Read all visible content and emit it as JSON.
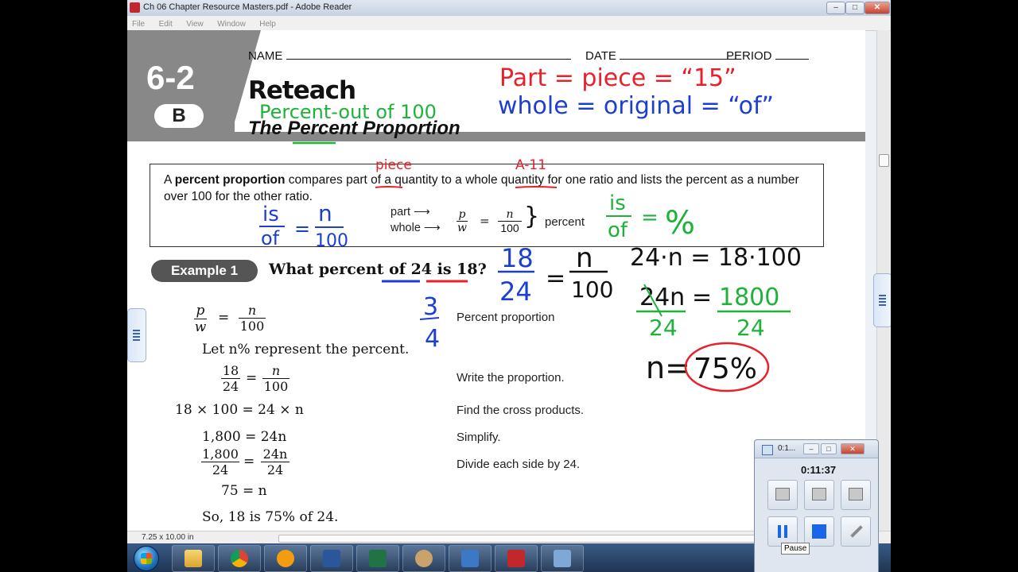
{
  "window": {
    "title": "Ch 06 Chapter Resource Masters.pdf - Adobe Reader",
    "min": "–",
    "max": "□",
    "close": "✕"
  },
  "menu": [
    "File",
    "Edit",
    "View",
    "Window",
    "Help"
  ],
  "doc": {
    "lesson_num": "6-2",
    "lesson_badge": "B",
    "name_label": "NAME",
    "date_label": "DATE",
    "period_label": "PERIOD",
    "heading": "Reteach",
    "subtitle": "The Percent Proportion",
    "def_bold": "percent proportion",
    "def_pre": "A ",
    "def_mid1": " compares ",
    "def_part": "part",
    "def_mid2": " of a quantity to a ",
    "def_whole": "whole",
    "def_post": " quantity for one ratio and lists the percent as a number over 100 for the other ratio.",
    "arrow_part": "part ⟶",
    "arrow_whole": "whole ⟶",
    "frac_p": "p",
    "frac_w": "w",
    "frac_n": "n",
    "frac_100": "100",
    "equals": "=",
    "brace": "}",
    "percent_word": "percent",
    "example_label": "Example 1",
    "example_q_pre": "What percent ",
    "example_q_of": "of 24",
    "example_q_is": "is 18",
    "example_q_end": "?",
    "eq1_p": "p",
    "eq1_w": "w",
    "eq1_n": "n",
    "eq1_100": "100",
    "let_line": "Let n% represent the percent.",
    "eq2_18": "18",
    "eq2_24": "24",
    "eq2_n": "n",
    "eq2_100": "100",
    "eq3": "18 × 100 = 24 × n",
    "eq4": "1,800 = 24n",
    "eq5_a": "1,800",
    "eq5_b": "24",
    "eq5_c": "24n",
    "eq5_d": "24",
    "eq6": "75 = n",
    "conclusion": "So, 18 is 75% of 24.",
    "steps": [
      "Percent proportion",
      "Write the proportion.",
      "Find the cross products.",
      "Simplify.",
      "Divide each side by 24."
    ]
  },
  "annotations": {
    "red_line1": "Part = piece = “15”",
    "blue_line2": "whole = original = “of”",
    "green_sub": "Percent-out of 100",
    "red_piece": "piece",
    "red_all": "A-11",
    "blue_is": "is",
    "blue_of": "of",
    "blue_eq": "=",
    "blue_n": "n",
    "blue_100": "100",
    "green_is": "is",
    "green_of": "of",
    "green_eq": "=",
    "green_pct": "%",
    "blue_18": "18",
    "blue_24": "24",
    "black_eq": "=",
    "black_n": "n",
    "black_100": "100",
    "black_cross": "24·n = 18·100",
    "black_24n": "24n",
    "black_eq2": "=",
    "black_1800": "1800",
    "green_24a": "24",
    "green_24b": "24",
    "blue_3": "3",
    "blue_4": "4",
    "black_n_eq": "n=",
    "red_75": "75%"
  },
  "status": {
    "page_size": "7.25 x 10.00 in"
  },
  "recorder": {
    "title": "0:1...",
    "time": "0:11:37",
    "tooltip": "Pause",
    "min": "–",
    "max": "□",
    "close": "✕"
  },
  "colors": {
    "ink_red": "#e8202a",
    "ink_blue": "#1c3fd1",
    "ink_green": "#1fb23a"
  }
}
